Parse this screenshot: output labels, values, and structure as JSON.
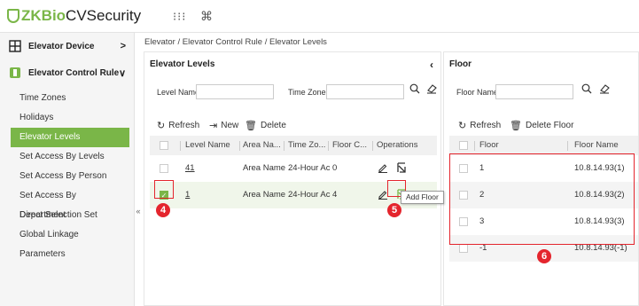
{
  "header": {
    "brand": "ZKBio",
    "product": " CVSecurity",
    "grid_glyph": "⁝⁝⁝",
    "cmd_glyph": "⌘"
  },
  "sidebar": {
    "groups": [
      {
        "label": "Elevator Device",
        "chevron": ">",
        "icon": "elevator-device-icon"
      },
      {
        "label": "Elevator Control Rule",
        "chevron": "∨",
        "icon": "elevator-control-rule-icon"
      }
    ],
    "items": [
      {
        "label": "Time Zones"
      },
      {
        "label": "Holidays"
      },
      {
        "label": "Elevator Levels",
        "active": true
      },
      {
        "label": "Set Access By Levels"
      },
      {
        "label": "Set Access By Person"
      },
      {
        "label": "Set Access By Department"
      },
      {
        "label": "Direct Selection Set"
      },
      {
        "label": "Global Linkage"
      },
      {
        "label": "Parameters"
      }
    ],
    "collapse_glyph": "«"
  },
  "breadcrumb": "Elevator / Elevator Control Rule / Elevator Levels",
  "levels_panel": {
    "title": "Elevator Levels",
    "close_glyph": "‹",
    "filter_level_label": "Level Name",
    "filter_level_value": "",
    "filter_tz_label": "Time Zones",
    "filter_tz_value": "",
    "toolbar": {
      "refresh": "Refresh",
      "new": "New",
      "delete": "Delete"
    },
    "columns": [
      "Level Name",
      "Area Na...",
      "Time Zo...",
      "Floor C...",
      "Operations"
    ],
    "rows": [
      {
        "level": "41",
        "area": "Area Name",
        "tz": "24-Hour Ac",
        "floors": "0",
        "checked": false
      },
      {
        "level": "1",
        "area": "Area Name",
        "tz": "24-Hour Ac",
        "floors": "4",
        "checked": true
      }
    ],
    "tooltip": "Add Floor"
  },
  "floor_panel": {
    "title": "Floor",
    "filter_label": "Floor Name",
    "filter_value": "",
    "toolbar": {
      "refresh": "Refresh",
      "delete_floor": "Delete Floor"
    },
    "columns": [
      "Floor",
      "Floor Name"
    ],
    "rows": [
      {
        "floor": "1",
        "name": "10.8.14.93(1)"
      },
      {
        "floor": "2",
        "name": "10.8.14.93(2)"
      },
      {
        "floor": "3",
        "name": "10.8.14.93(3)"
      },
      {
        "floor": "-1",
        "name": "10.8.14.93(-1)"
      }
    ]
  },
  "callouts": {
    "four": "4",
    "five": "5",
    "six": "6"
  },
  "colors": {
    "accent": "#7ab648",
    "callout": "#e4252d"
  }
}
